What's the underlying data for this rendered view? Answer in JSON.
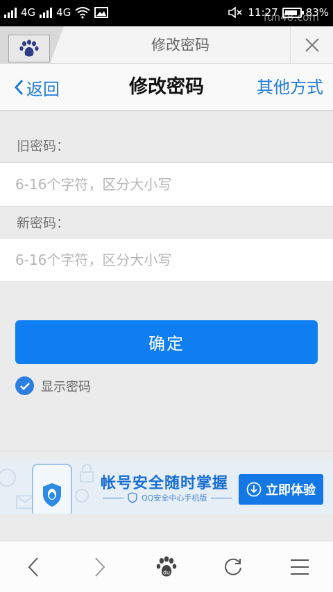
{
  "status_bar": {
    "network1": "4G",
    "network2": "4G",
    "time": "11:27",
    "battery": "83%",
    "battery_level": 0.83,
    "watermark": "fun48.com"
  },
  "browser": {
    "title": "修改密码",
    "close_icon": "close-icon"
  },
  "header": {
    "back_label": "返回",
    "title": "修改密码",
    "other_label": "其他方式"
  },
  "form": {
    "old_label": "旧密码：",
    "old_placeholder": "6-16个字符，区分大小写",
    "old_value": "",
    "new_label": "新密码：",
    "new_placeholder": "6-16个字符，区分大小写",
    "new_value": "",
    "confirm_label": "确定",
    "show_password_label": "显示密码",
    "show_password_checked": true
  },
  "banner": {
    "title": "帐号安全随时掌握",
    "subtitle": "QQ安全中心手机版",
    "button_label": "立即体验"
  },
  "bottom_nav": {
    "items": [
      "back-icon",
      "forward-icon",
      "baidu-paw-icon",
      "refresh-icon",
      "menu-icon"
    ]
  },
  "colors": {
    "accent": "#1f7bd8",
    "button": "#0f7ef0",
    "banner_button": "#1477e6"
  }
}
